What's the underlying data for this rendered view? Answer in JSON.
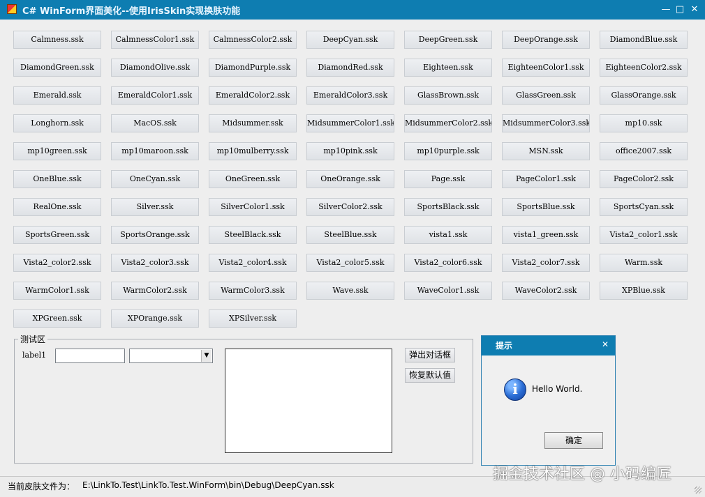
{
  "window": {
    "title": "C# WinForm界面美化--使用IrisSkin实现换肤功能",
    "icon": "app-icon",
    "controls": [
      "minimize-icon",
      "maximize-icon",
      "close-icon"
    ]
  },
  "skins": [
    "Calmness.ssk",
    "CalmnessColor1.ssk",
    "CalmnessColor2.ssk",
    "DeepCyan.ssk",
    "DeepGreen.ssk",
    "DeepOrange.ssk",
    "DiamondBlue.ssk",
    "DiamondGreen.ssk",
    "DiamondOlive.ssk",
    "DiamondPurple.ssk",
    "DiamondRed.ssk",
    "Eighteen.ssk",
    "EighteenColor1.ssk",
    "EighteenColor2.ssk",
    "Emerald.ssk",
    "EmeraldColor1.ssk",
    "EmeraldColor2.ssk",
    "EmeraldColor3.ssk",
    "GlassBrown.ssk",
    "GlassGreen.ssk",
    "GlassOrange.ssk",
    "Longhorn.ssk",
    "MacOS.ssk",
    "Midsummer.ssk",
    "MidsummerColor1.ssk",
    "MidsummerColor2.ssk",
    "MidsummerColor3.ssk",
    "mp10.ssk",
    "mp10green.ssk",
    "mp10maroon.ssk",
    "mp10mulberry.ssk",
    "mp10pink.ssk",
    "mp10purple.ssk",
    "MSN.ssk",
    "office2007.ssk",
    "OneBlue.ssk",
    "OneCyan.ssk",
    "OneGreen.ssk",
    "OneOrange.ssk",
    "Page.ssk",
    "PageColor1.ssk",
    "PageColor2.ssk",
    "RealOne.ssk",
    "Silver.ssk",
    "SilverColor1.ssk",
    "SilverColor2.ssk",
    "SportsBlack.ssk",
    "SportsBlue.ssk",
    "SportsCyan.ssk",
    "SportsGreen.ssk",
    "SportsOrange.ssk",
    "SteelBlack.ssk",
    "SteelBlue.ssk",
    "vista1.ssk",
    "vista1_green.ssk",
    "Vista2_color1.ssk",
    "Vista2_color2.ssk",
    "Vista2_color3.ssk",
    "Vista2_color4.ssk",
    "Vista2_color5.ssk",
    "Vista2_color6.ssk",
    "Vista2_color7.ssk",
    "Warm.ssk",
    "WarmColor1.ssk",
    "WarmColor2.ssk",
    "WarmColor3.ssk",
    "Wave.ssk",
    "WaveColor1.ssk",
    "WaveColor2.ssk",
    "XPBlue.ssk",
    "XPGreen.ssk",
    "XPOrange.ssk",
    "XPSilver.ssk"
  ],
  "test_area": {
    "group_title": "测试区",
    "label": "label1",
    "textbox_value": "",
    "combo_value": "",
    "memo_value": "",
    "buttons": [
      "弹出对话框",
      "恢复默认值"
    ]
  },
  "dialog": {
    "title": "提示",
    "message": "Hello World.",
    "ok_label": "确定",
    "icon": "info-icon",
    "icon_glyph": "i"
  },
  "status": {
    "label": "当前皮肤文件为：",
    "path": "E:\\LinkTo.Test\\LinkTo.Test.WinForm\\bin\\Debug\\DeepCyan.ssk"
  },
  "watermark": "掘金技术社区 @ 小码编匠",
  "colors": {
    "title_bar": "#0e7db1",
    "background": "#eeeeee",
    "button_face": "#e2e5e8"
  }
}
